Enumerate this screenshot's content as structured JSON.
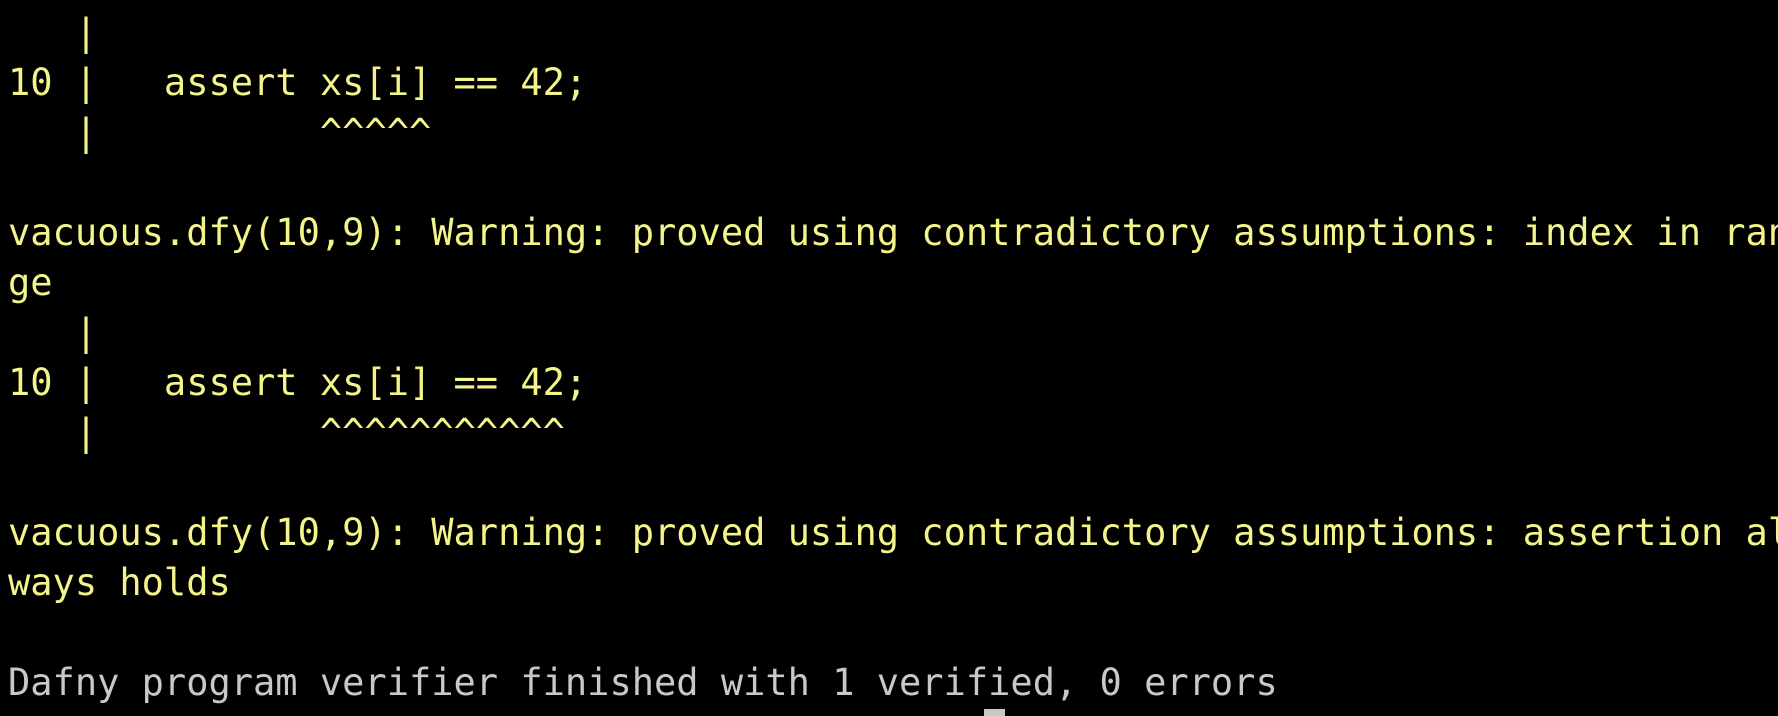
{
  "terminal": {
    "lines": [
      "   |",
      "10 |   assert xs[i] == 42;",
      "   |          ^^^^^",
      "",
      "vacuous.dfy(10,9): Warning: proved using contradictory assumptions: index in ran",
      "ge",
      "   |",
      "10 |   assert xs[i] == 42;",
      "   |          ^^^^^^^^^^^",
      "",
      "vacuous.dfy(10,9): Warning: proved using contradictory assumptions: assertion al",
      "ways holds",
      "",
      "Dafny program verifier finished with 1 verified, 0 errors"
    ],
    "colors": {
      "warning_text": "#f4f48a",
      "summary_text": "#c8c8c8",
      "background": "#000000"
    }
  }
}
